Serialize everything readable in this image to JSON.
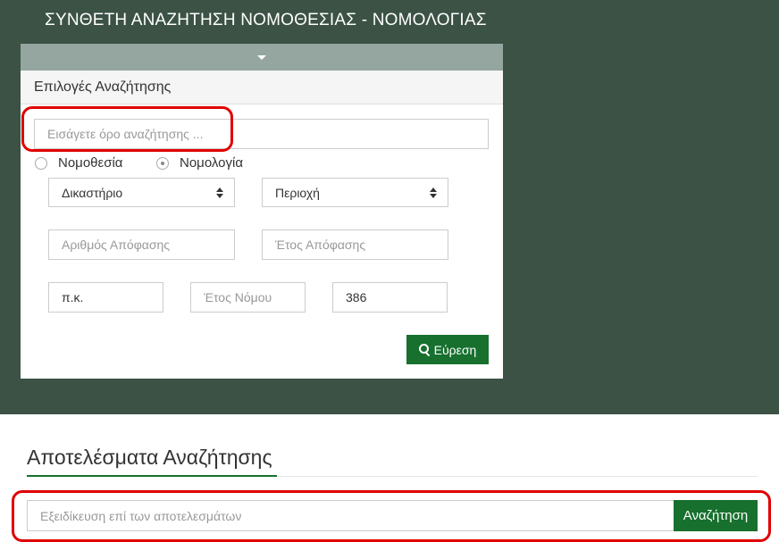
{
  "header": {
    "title": "ΣΥΝΘΕΤΗ ΑΝΑΖΗΤΗΣΗ ΝΟΜΟΘΕΣΙΑΣ - ΝΟΜΟΛΟΓΙΑΣ"
  },
  "search_panel": {
    "toggle_icon": "caret-down-icon",
    "heading": "Επιλογές Αναζήτησης",
    "term_input": {
      "placeholder": "Εισάγετε όρο αναζήτησης ...",
      "value": ""
    },
    "search_type": {
      "options": [
        {
          "label": "Νομοθεσία",
          "selected": false
        },
        {
          "label": "Νομολογία",
          "selected": true
        }
      ]
    },
    "court_select": {
      "value": "Δικαστήριο"
    },
    "region_select": {
      "value": "Περιοχή"
    },
    "decision_number": {
      "placeholder": "Αριθμός Απόφασης",
      "value": ""
    },
    "decision_year": {
      "placeholder": "Έτος Απόφασης",
      "value": ""
    },
    "law_type": {
      "value": "π.κ."
    },
    "law_year": {
      "placeholder": "Έτος Νόμου",
      "value": ""
    },
    "law_number": {
      "value": "386"
    },
    "find_button": {
      "label": "Εύρεση",
      "icon": "search-icon"
    }
  },
  "results": {
    "title": "Αποτελέσματα Αναζήτησης",
    "refine_input": {
      "placeholder": "Εξειδίκευση επί των αποτελεσμάτων",
      "value": ""
    },
    "refine_button": {
      "label": "Αναζήτηση"
    }
  },
  "colors": {
    "header_background": "#3b5245",
    "toggle_bar": "#95a5a0",
    "primary_button": "#17702e",
    "highlight": "#e00000"
  }
}
